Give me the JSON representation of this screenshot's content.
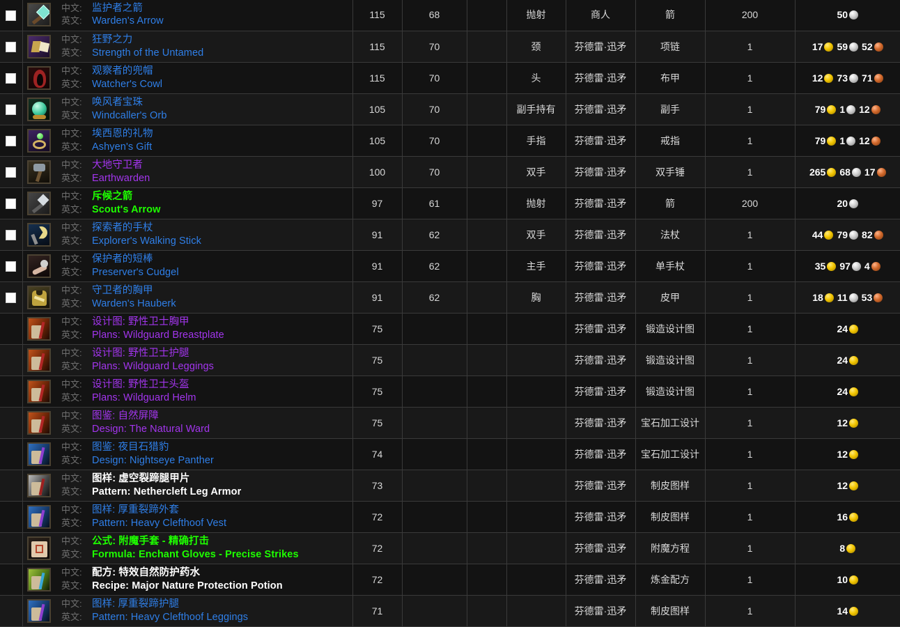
{
  "labels": {
    "cn": "中文:",
    "en": "英文:"
  },
  "rows": [
    {
      "checkbox": true,
      "icon": "arrow-teal-icon",
      "quality": "rare",
      "cn": "监护者之箭",
      "en": "Warden's Arrow",
      "level": "115",
      "req": "68",
      "blank": "",
      "slot": "抛射",
      "source": "商人",
      "type": "箭",
      "qty": "200",
      "cost": [
        {
          "value": "50",
          "coin": "silver"
        }
      ]
    },
    {
      "checkbox": true,
      "icon": "amulet-purple-icon",
      "quality": "rare",
      "cn": "狂野之力",
      "en": "Strength of the Untamed",
      "level": "115",
      "req": "70",
      "blank": "",
      "slot": "颈",
      "source": "芬德雷·迅矛",
      "type": "项链",
      "qty": "1",
      "cost": [
        {
          "value": "17",
          "coin": "gold"
        },
        {
          "value": "59",
          "coin": "silver"
        },
        {
          "value": "52",
          "coin": "copper"
        }
      ]
    },
    {
      "checkbox": true,
      "icon": "cowl-red-icon",
      "quality": "rare",
      "cn": "观察者的兜帽",
      "en": "Watcher's Cowl",
      "level": "115",
      "req": "70",
      "blank": "",
      "slot": "头",
      "source": "芬德雷·迅矛",
      "type": "布甲",
      "qty": "1",
      "cost": [
        {
          "value": "12",
          "coin": "gold"
        },
        {
          "value": "73",
          "coin": "silver"
        },
        {
          "value": "71",
          "coin": "copper"
        }
      ]
    },
    {
      "checkbox": true,
      "icon": "orb-green-icon",
      "quality": "rare",
      "cn": "唤风者宝珠",
      "en": "Windcaller's Orb",
      "level": "105",
      "req": "70",
      "blank": "",
      "slot": "副手持有",
      "source": "芬德雷·迅矛",
      "type": "副手",
      "qty": "1",
      "cost": [
        {
          "value": "79",
          "coin": "gold"
        },
        {
          "value": "1",
          "coin": "silver"
        },
        {
          "value": "12",
          "coin": "copper"
        }
      ]
    },
    {
      "checkbox": true,
      "icon": "ring-gem-icon",
      "quality": "rare",
      "cn": "埃西恩的礼物",
      "en": "Ashyen's Gift",
      "level": "105",
      "req": "70",
      "blank": "",
      "slot": "手指",
      "source": "芬德雷·迅矛",
      "type": "戒指",
      "qty": "1",
      "cost": [
        {
          "value": "79",
          "coin": "gold"
        },
        {
          "value": "1",
          "coin": "silver"
        },
        {
          "value": "12",
          "coin": "copper"
        }
      ]
    },
    {
      "checkbox": true,
      "icon": "mace-twohand-icon",
      "quality": "epic",
      "cn": "大地守卫者",
      "en": "Earthwarden",
      "level": "100",
      "req": "70",
      "blank": "",
      "slot": "双手",
      "source": "芬德雷·迅矛",
      "type": "双手锤",
      "qty": "1",
      "cost": [
        {
          "value": "265",
          "coin": "gold"
        },
        {
          "value": "68",
          "coin": "silver"
        },
        {
          "value": "17",
          "coin": "copper"
        }
      ]
    },
    {
      "checkbox": true,
      "icon": "arrow-gray-icon",
      "quality": "uncommon",
      "cn": "斥候之箭",
      "en": "Scout's Arrow",
      "level": "97",
      "req": "61",
      "blank": "",
      "slot": "抛射",
      "source": "芬德雷·迅矛",
      "type": "箭",
      "qty": "200",
      "cost": [
        {
          "value": "20",
          "coin": "silver"
        }
      ]
    },
    {
      "checkbox": true,
      "icon": "staff-moon-icon",
      "quality": "rare",
      "cn": "探索者的手杖",
      "en": "Explorer's Walking Stick",
      "level": "91",
      "req": "62",
      "blank": "",
      "slot": "双手",
      "source": "芬德雷·迅矛",
      "type": "法杖",
      "qty": "1",
      "cost": [
        {
          "value": "44",
          "coin": "gold"
        },
        {
          "value": "79",
          "coin": "silver"
        },
        {
          "value": "82",
          "coin": "copper"
        }
      ]
    },
    {
      "checkbox": true,
      "icon": "cudgel-icon",
      "quality": "rare",
      "cn": "保护者的短棒",
      "en": "Preserver's Cudgel",
      "level": "91",
      "req": "62",
      "blank": "",
      "slot": "主手",
      "source": "芬德雷·迅矛",
      "type": "单手杖",
      "qty": "1",
      "cost": [
        {
          "value": "35",
          "coin": "gold"
        },
        {
          "value": "97",
          "coin": "silver"
        },
        {
          "value": "4",
          "coin": "copper"
        }
      ]
    },
    {
      "checkbox": true,
      "icon": "hauberk-gold-icon",
      "quality": "rare",
      "cn": "守卫者的胸甲",
      "en": "Warden's Hauberk",
      "level": "91",
      "req": "62",
      "blank": "",
      "slot": "胸",
      "source": "芬德雷·迅矛",
      "type": "皮甲",
      "qty": "1",
      "cost": [
        {
          "value": "18",
          "coin": "gold"
        },
        {
          "value": "11",
          "coin": "silver"
        },
        {
          "value": "53",
          "coin": "copper"
        }
      ]
    },
    {
      "checkbox": false,
      "icon": "scroll-red-icon",
      "quality": "epic",
      "cn": "设计图: 野性卫士胸甲",
      "en": "Plans: Wildguard Breastplate",
      "level": "75",
      "req": "",
      "blank": "",
      "slot": "",
      "source": "芬德雷·迅矛",
      "type": "锻造设计图",
      "qty": "1",
      "cost": [
        {
          "value": "24",
          "coin": "gold"
        }
      ]
    },
    {
      "checkbox": false,
      "icon": "scroll-red-icon",
      "quality": "epic",
      "cn": "设计图: 野性卫士护腿",
      "en": "Plans: Wildguard Leggings",
      "level": "75",
      "req": "",
      "blank": "",
      "slot": "",
      "source": "芬德雷·迅矛",
      "type": "锻造设计图",
      "qty": "1",
      "cost": [
        {
          "value": "24",
          "coin": "gold"
        }
      ]
    },
    {
      "checkbox": false,
      "icon": "scroll-red-icon",
      "quality": "epic",
      "cn": "设计图: 野性卫士头盔",
      "en": "Plans: Wildguard Helm",
      "level": "75",
      "req": "",
      "blank": "",
      "slot": "",
      "source": "芬德雷·迅矛",
      "type": "锻造设计图",
      "qty": "1",
      "cost": [
        {
          "value": "24",
          "coin": "gold"
        }
      ]
    },
    {
      "checkbox": false,
      "icon": "scroll-red-icon",
      "quality": "epic",
      "cn": "图鉴: 自然屏障",
      "en": "Design: The Natural Ward",
      "level": "75",
      "req": "",
      "blank": "",
      "slot": "",
      "source": "芬德雷·迅矛",
      "type": "宝石加工设计",
      "qty": "1",
      "cost": [
        {
          "value": "12",
          "coin": "gold"
        }
      ]
    },
    {
      "checkbox": false,
      "icon": "scroll-blue-icon",
      "quality": "rare",
      "cn": "图鉴: 夜目石猎豹",
      "en": "Design: Nightseye Panther",
      "level": "74",
      "req": "",
      "blank": "",
      "slot": "",
      "source": "芬德雷·迅矛",
      "type": "宝石加工设计",
      "qty": "1",
      "cost": [
        {
          "value": "12",
          "coin": "gold"
        }
      ]
    },
    {
      "checkbox": false,
      "icon": "scroll-white-icon",
      "quality": "common",
      "cn": "图样: 虚空裂蹄腿甲片",
      "en": "Pattern: Nethercleft Leg Armor",
      "level": "73",
      "req": "",
      "blank": "",
      "slot": "",
      "source": "芬德雷·迅矛",
      "type": "制皮图样",
      "qty": "1",
      "cost": [
        {
          "value": "12",
          "coin": "gold"
        }
      ]
    },
    {
      "checkbox": false,
      "icon": "scroll-blue-icon",
      "quality": "rare",
      "cn": "图样: 厚重裂蹄外套",
      "en": "Pattern: Heavy Clefthoof Vest",
      "level": "72",
      "req": "",
      "blank": "",
      "slot": "",
      "source": "芬德雷·迅矛",
      "type": "制皮图样",
      "qty": "1",
      "cost": [
        {
          "value": "16",
          "coin": "gold"
        }
      ]
    },
    {
      "checkbox": false,
      "icon": "formula-parchment-icon",
      "quality": "uncommon",
      "cn": "公式: 附魔手套 - 精确打击",
      "en": "Formula: Enchant Gloves - Precise Strikes",
      "level": "72",
      "req": "",
      "blank": "",
      "slot": "",
      "source": "芬德雷·迅矛",
      "type": "附魔方程",
      "qty": "1",
      "cost": [
        {
          "value": "8",
          "coin": "gold"
        }
      ]
    },
    {
      "checkbox": false,
      "icon": "scroll-green-icon",
      "quality": "common",
      "cn": "配方: 特效自然防护药水",
      "en": "Recipe: Major Nature Protection Potion",
      "level": "72",
      "req": "",
      "blank": "",
      "slot": "",
      "source": "芬德雷·迅矛",
      "type": "炼金配方",
      "qty": "1",
      "cost": [
        {
          "value": "10",
          "coin": "gold"
        }
      ]
    },
    {
      "checkbox": false,
      "icon": "scroll-blue-icon",
      "quality": "rare",
      "cn": "图样: 厚重裂蹄护腿",
      "en": "Pattern: Heavy Clefthoof Leggings",
      "level": "71",
      "req": "",
      "blank": "",
      "slot": "",
      "source": "芬德雷·迅矛",
      "type": "制皮图样",
      "qty": "1",
      "cost": [
        {
          "value": "14",
          "coin": "gold"
        }
      ]
    }
  ]
}
